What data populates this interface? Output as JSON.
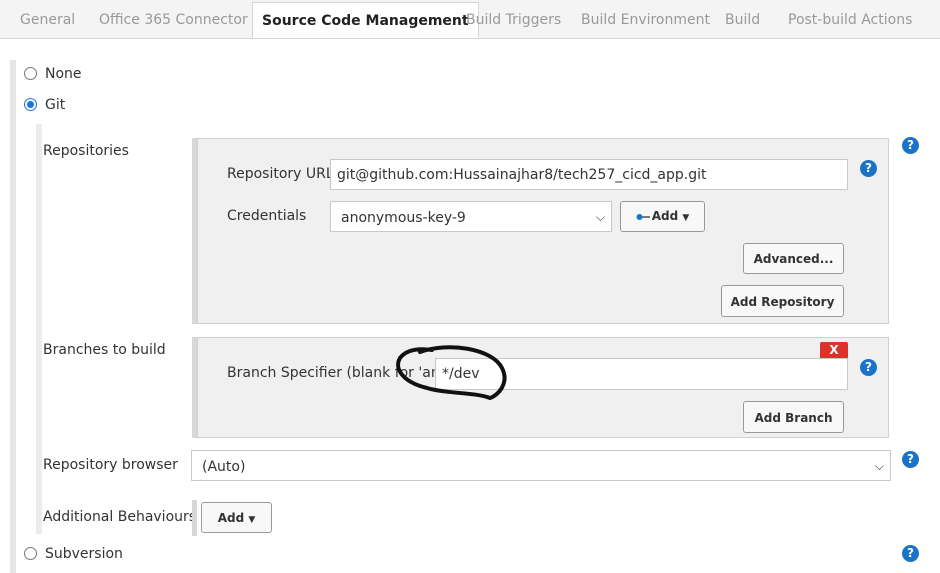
{
  "tabs": {
    "general": "General",
    "office365": "Office 365 Connector",
    "scm": "Source Code Management",
    "triggers": "Build Triggers",
    "environment": "Build Environment",
    "build": "Build",
    "post_build": "Post-build Actions"
  },
  "scm": {
    "none_label": "None",
    "git_label": "Git",
    "subversion_label": "Subversion",
    "selected": "Git"
  },
  "repositories": {
    "section_label": "Repositories",
    "url_label": "Repository URL",
    "url_value": "git@github.com:Hussainajhar8/tech257_cicd_app.git",
    "credentials_label": "Credentials",
    "credentials_value": "anonymous-key-9",
    "add_label": "Add",
    "advanced_label": "Advanced...",
    "add_repository_label": "Add Repository"
  },
  "branches": {
    "section_label": "Branches to build",
    "specifier_label": "Branch Specifier (blank for 'any')",
    "specifier_value": "*/dev",
    "delete_label": "X",
    "add_branch_label": "Add Branch"
  },
  "repo_browser": {
    "label": "Repository browser",
    "value": "(Auto)"
  },
  "additional": {
    "label": "Additional Behaviours",
    "add_label": "Add"
  },
  "help_glyph": "?",
  "colors": {
    "accent": "#1a73c8",
    "delete": "#d9342b",
    "annotation": "#111111"
  }
}
